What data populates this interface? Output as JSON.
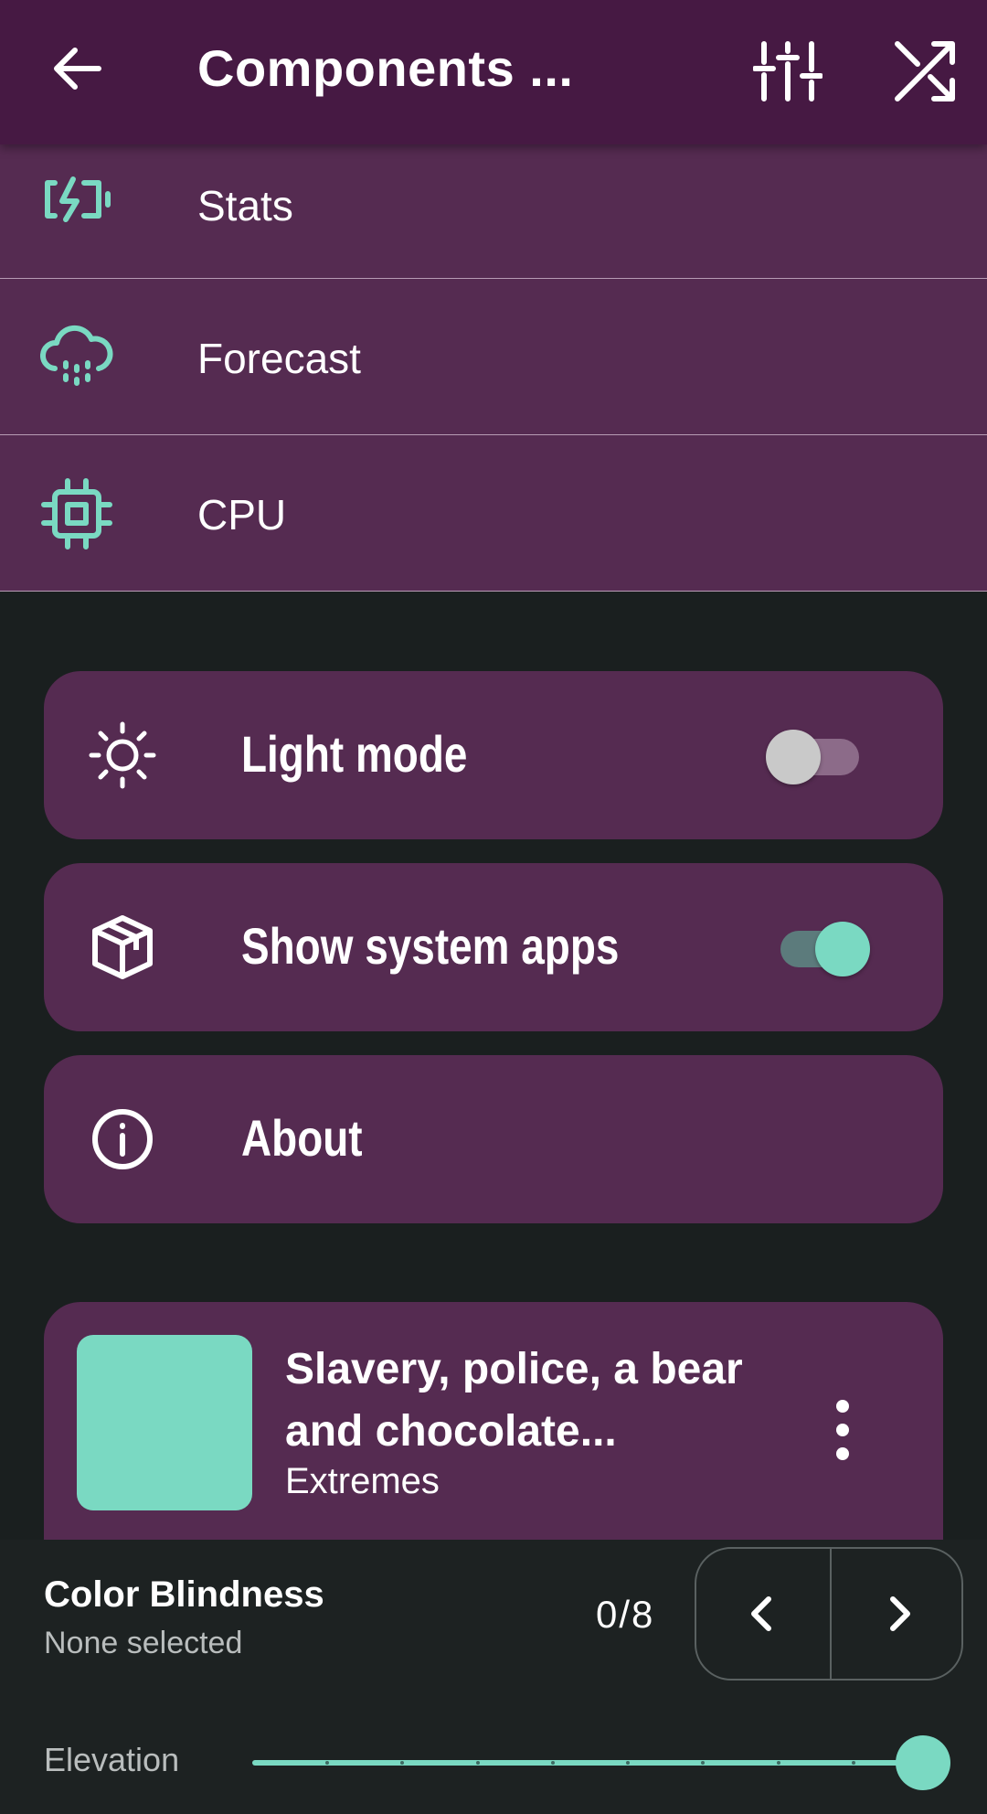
{
  "appbar": {
    "title": "Components ...",
    "icons": [
      "back-arrow-icon",
      "tune-sliders-icon",
      "shuffle-icon"
    ]
  },
  "list": [
    {
      "label": "Stats",
      "icon": "battery-charging-icon"
    },
    {
      "label": "Forecast",
      "icon": "cloud-rain-icon"
    },
    {
      "label": "CPU",
      "icon": "cpu-chip-icon"
    }
  ],
  "settings": {
    "light_mode": {
      "label": "Light mode",
      "enabled": false
    },
    "system_apps": {
      "label": "Show system apps",
      "enabled": true
    },
    "about": {
      "label": "About"
    }
  },
  "song": {
    "title": "Slavery, police, a bear and chocolate...",
    "subtitle": "Extremes"
  },
  "color_blindness": {
    "title": "Color Blindness",
    "subtitle": "None selected",
    "count": "0/8"
  },
  "elevation": {
    "label": "Elevation",
    "level": 1.0,
    "steps": 9
  },
  "colors": {
    "appbar": "#461943",
    "surface": "#552b51",
    "accent": "#7ad9c2",
    "background": "#1a1f1f"
  }
}
